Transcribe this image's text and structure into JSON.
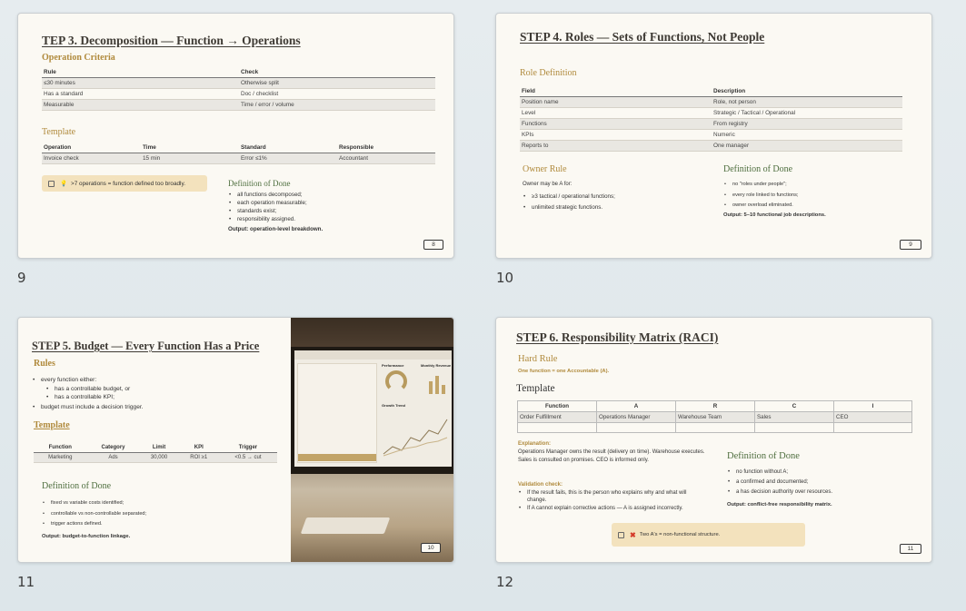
{
  "slides": [
    {
      "number": "9",
      "title": "TEP 3. Decomposition — Function → Operations",
      "criteria_heading": "Operation Criteria",
      "criteria_table": {
        "headers": [
          "Rule",
          "Check"
        ],
        "rows": [
          [
            "≤30 minutes",
            "Otherwise split"
          ],
          [
            "Has a standard",
            "Doc / checklist"
          ],
          [
            "Measurable",
            "Time / error / volume"
          ]
        ]
      },
      "template_heading": "Template",
      "template_table": {
        "headers": [
          "Operation",
          "Time",
          "Standard",
          "Responsible"
        ],
        "rows": [
          [
            "Invoice check",
            "15 min",
            "Error ≤1%",
            "Accountant"
          ]
        ]
      },
      "note": ">7 operations = function defined too broadly.",
      "dod_heading": "Definition of Done",
      "dod_items": [
        "all functions decomposed;",
        "each operation measurable;",
        "standards exist;",
        "responsibility assigned."
      ],
      "output": "Output: operation-level breakdown.",
      "page": "8"
    },
    {
      "number": "10",
      "title": "STEP 4. Roles — Sets of Functions, Not People",
      "role_heading": "Role Definition",
      "role_table": {
        "headers": [
          "Field",
          "Description"
        ],
        "rows": [
          [
            "Position name",
            "Role, not person"
          ],
          [
            "Level",
            "Strategic / Tactical / Operational"
          ],
          [
            "Functions",
            "From registry"
          ],
          [
            "KPIs",
            "Numeric"
          ],
          [
            "Reports to",
            "One manager"
          ]
        ]
      },
      "owner_heading": "Owner Rule",
      "owner_intro": "Owner may be A for:",
      "owner_items": [
        "≥3 tactical / operational functions;",
        "unlimited strategic functions."
      ],
      "dod_heading": "Definition of Done",
      "dod_items": [
        "no \"roles under people\";",
        "every role linked to functions;",
        "owner overload eliminated."
      ],
      "output": "Output: 5–10 functional job descriptions.",
      "page": "9"
    },
    {
      "number": "11",
      "title": "STEP 5. Budget — Every Function Has a Price",
      "rules_heading": "Rules",
      "rules_intro": "every function either:",
      "rules_sub": [
        "has a controllable budget, or",
        "has a controllable KPI;"
      ],
      "rules_last": "budget must include a decision trigger.",
      "template_heading": "Template",
      "template_table": {
        "headers": [
          "Function",
          "Category",
          "Limit",
          "KPI",
          "Trigger"
        ],
        "rows": [
          [
            "Marketing",
            "Ads",
            "30,000",
            "ROI ≥1",
            "<0.5 → cut"
          ]
        ]
      },
      "dod_heading": "Definition of Done",
      "dod_items": [
        "fixed vs variable costs identified;",
        "controllable vs non-controllable separated;",
        "trigger actions defined."
      ],
      "output": "Output: budget-to-function linkage.",
      "dashboard_title": "Performance",
      "dashboard_title2": "Monthly Revenue",
      "dashboard_title3": "Growth Trend",
      "page": "10"
    },
    {
      "number": "12",
      "title": "STEP 6. Responsibility Matrix (RACI)",
      "hard_heading": "Hard Rule",
      "hard_rule": "One function = one Accountable (A).",
      "template_heading": "Template",
      "raci_table": {
        "headers": [
          "Function",
          "A",
          "R",
          "C",
          "I"
        ],
        "rows": [
          [
            "Order Fulfillment",
            "Operations Manager",
            "Warehouse Team",
            "Sales",
            "CEO"
          ],
          [
            "",
            "",
            "",
            "",
            ""
          ]
        ]
      },
      "explanation_label": "Explanation:",
      "explanation_text": "Operations Manager owns the result (delivery on time). Warehouse executes. Sales is consulted on promises. CEO is informed only.",
      "validation_label": "Validation check:",
      "validation_items": [
        "If the result fails, this is the person who explains why and what will change.",
        "If A cannot explain corrective actions — A is assigned incorrectly."
      ],
      "dod_heading": "Definition of Done",
      "dod_items": [
        "no function without A;",
        "a confirmed and documented;",
        "a has decision authority over resources."
      ],
      "output": "Output: conflict-free responsibility matrix.",
      "note": "Two A's = non-functional structure.",
      "page": "11"
    }
  ],
  "colors": {
    "gold": "#b08a3c",
    "green": "#4e6e3e",
    "note": "#f3e2bd",
    "slide_bg": "#fbf9f3"
  }
}
